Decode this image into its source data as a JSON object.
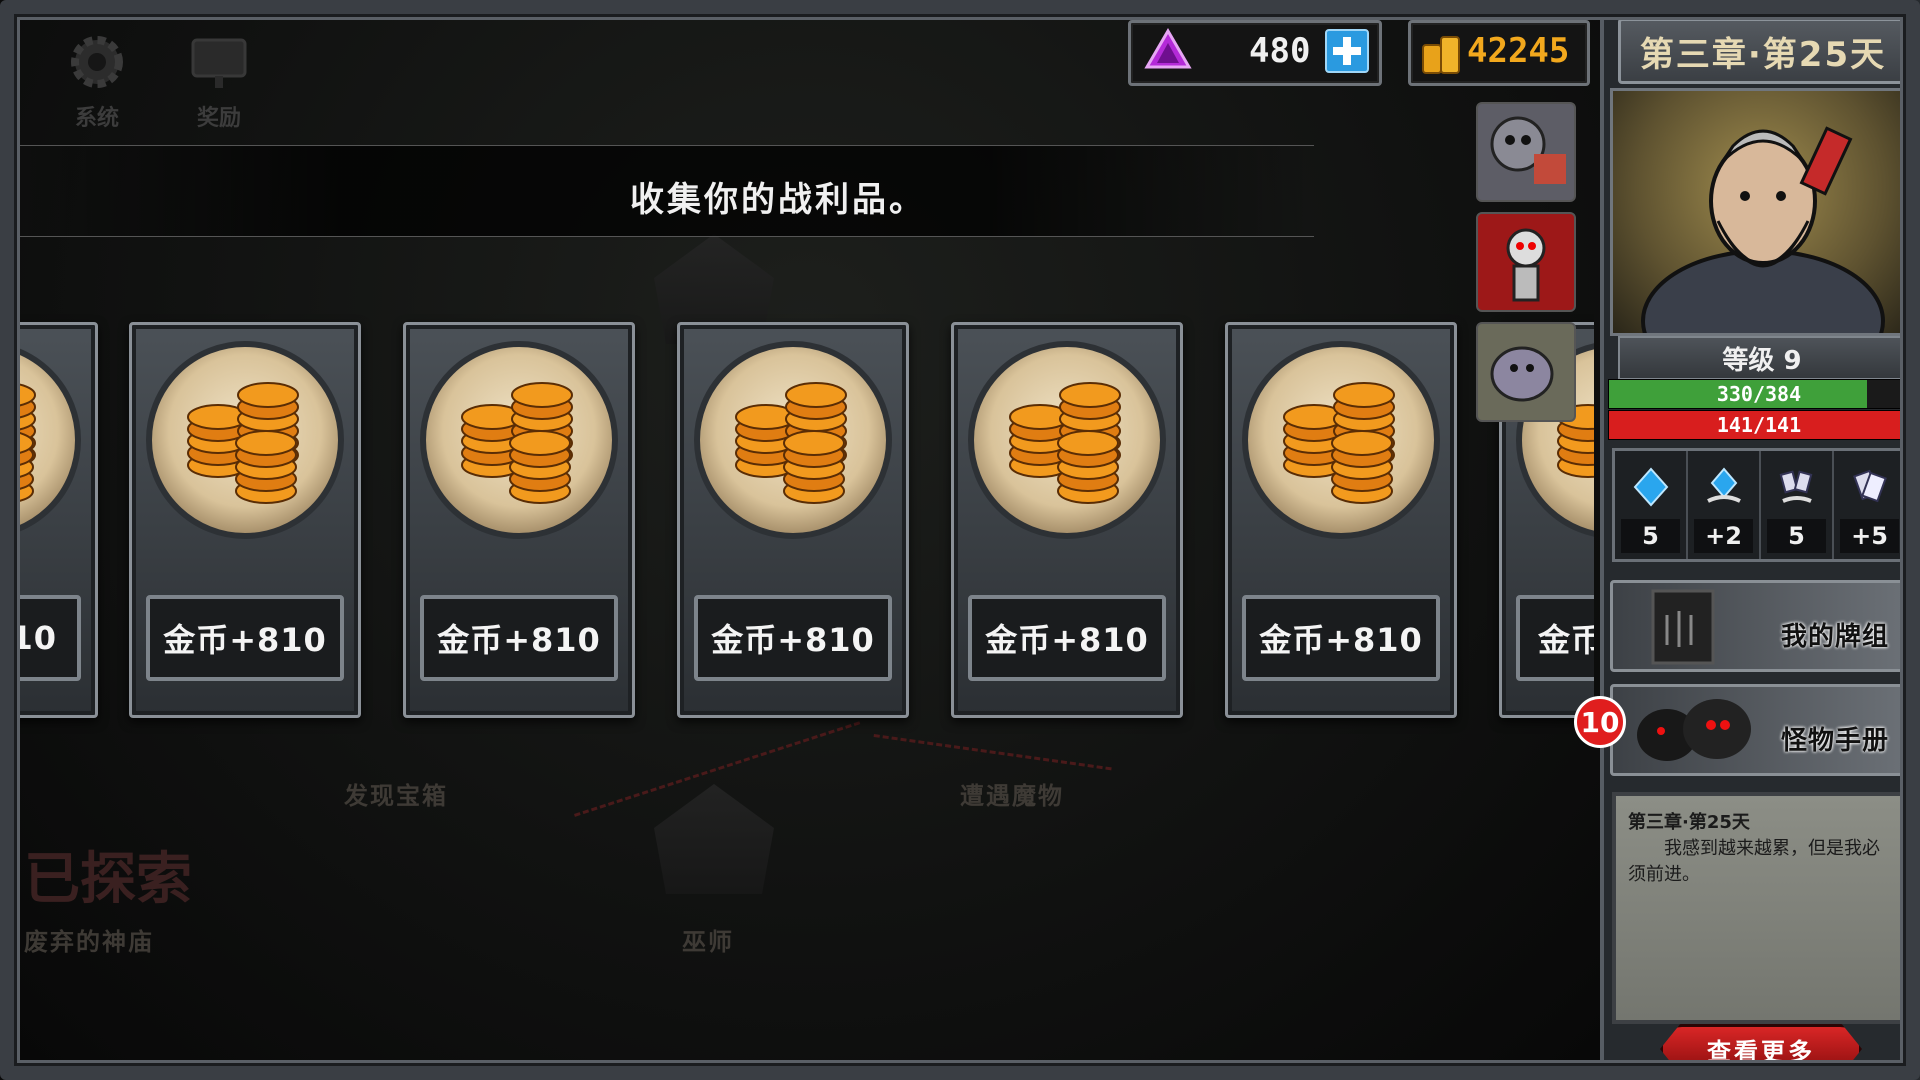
{
  "top_left": {
    "system_label": "系统",
    "reward_label": "奖励"
  },
  "currency": {
    "gems": "480",
    "gold": "42245"
  },
  "loot_screen": {
    "title": "收集你的战利品。",
    "cards": [
      {
        "label": "10"
      },
      {
        "label": "金币+810"
      },
      {
        "label": "金币+810"
      },
      {
        "label": "金币+810"
      },
      {
        "label": "金币+810"
      },
      {
        "label": "金币+810"
      },
      {
        "label": "金币"
      }
    ]
  },
  "map": {
    "labels": [
      "已探索",
      "发现宝箱",
      "遭遇魔物",
      "巫师",
      "废弃的神庙"
    ]
  },
  "sidebar": {
    "chapter_title": "第三章·第25天",
    "level": "等级 9",
    "xp_text": "330/384",
    "xp_fraction": 0.86,
    "hp_text": "141/141",
    "hp_fraction": 1.0,
    "stats": [
      {
        "icon": "blue-diamond-icon",
        "value": "5"
      },
      {
        "icon": "hand-diamond-icon",
        "value": "+2"
      },
      {
        "icon": "hand-cards-icon",
        "value": "5"
      },
      {
        "icon": "cards-icon",
        "value": "+5"
      }
    ],
    "deck_button": "我的牌组",
    "monster_button": "怪物手册",
    "monster_badge": "10",
    "journal_title": "第三章·第25天",
    "journal_text": "我感到越来越累，但是我必须前进。",
    "see_more": "查看更多"
  },
  "colors": {
    "xp_green": "#3fa03a",
    "hp_red": "#d81e1e",
    "gold_text": "#f2a81d",
    "gem_purple": "#b42ad8",
    "plus_blue": "#2a9ae0"
  }
}
